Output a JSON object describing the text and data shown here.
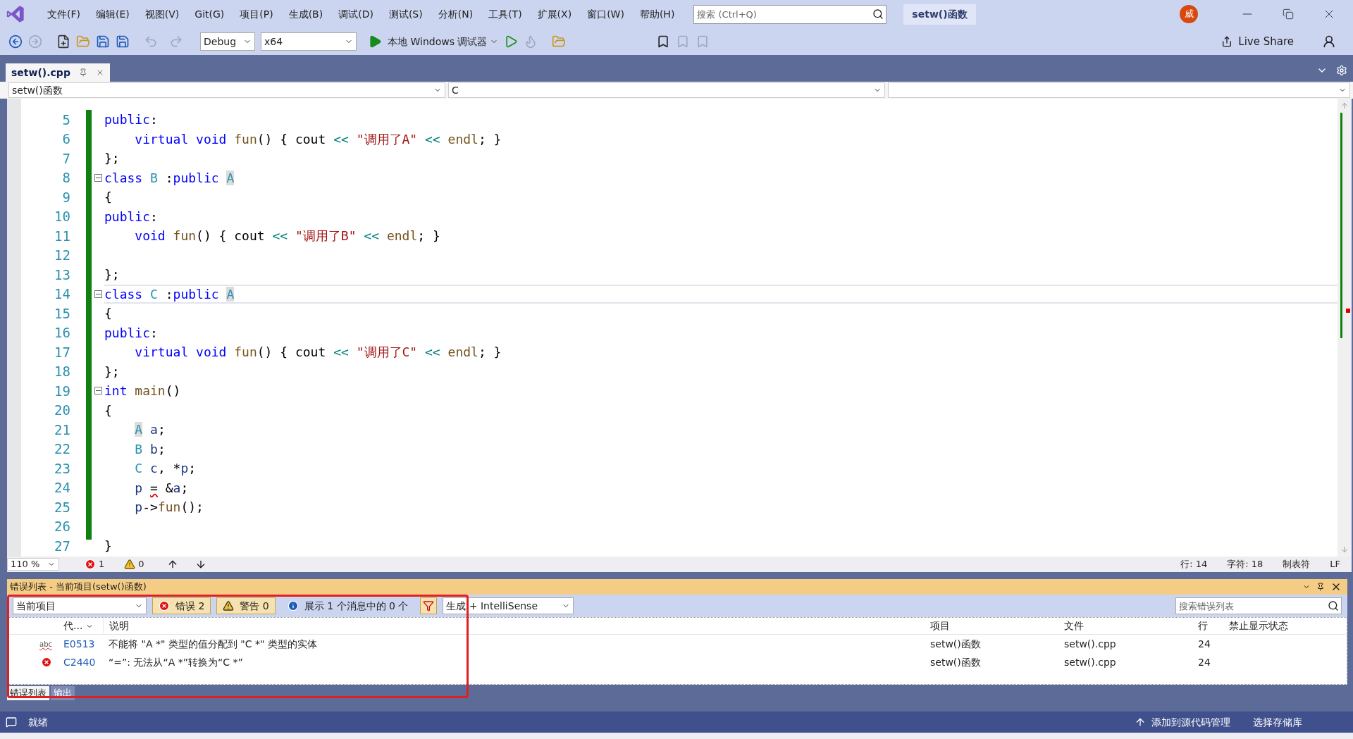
{
  "title_bar": {
    "menu": [
      "文件(F)",
      "编辑(E)",
      "视图(V)",
      "Git(G)",
      "项目(P)",
      "生成(B)",
      "调试(D)",
      "测试(S)",
      "分析(N)",
      "工具(T)",
      "扩展(X)",
      "窗口(W)",
      "帮助(H)"
    ],
    "search": {
      "placeholder": "搜索 (Ctrl+Q)"
    },
    "solution_name": "setw()函数",
    "avatar": "威"
  },
  "toolbar": {
    "configuration": "Debug",
    "platform": "x64",
    "run_target": "本地 Windows 调试器",
    "live_share": "Live Share"
  },
  "document_tab": {
    "title": "setw().cpp",
    "selected": true
  },
  "nav_bar": {
    "scope": "setw()函数",
    "class": "C"
  },
  "code": {
    "lines": [
      {
        "number": "5",
        "fold": false,
        "current": false,
        "tokens": [
          {
            "kind": "kw",
            "text": "public"
          },
          {
            "kind": "plain",
            "text": ":"
          }
        ]
      },
      {
        "number": "6",
        "fold": false,
        "current": false,
        "tokens": [
          {
            "kind": "kw",
            "text": "    virtual void"
          },
          {
            "kind": "fn",
            "text": " fun"
          },
          {
            "kind": "plain",
            "text": "() { cout "
          },
          {
            "kind": "op",
            "text": "<<"
          },
          {
            "kind": "str",
            "text": " \"调用了A\""
          },
          {
            "kind": "op",
            "text": " <<"
          },
          {
            "kind": "fn",
            "text": " endl"
          },
          {
            "kind": "plain",
            "text": "; }"
          }
        ]
      },
      {
        "number": "7",
        "fold": false,
        "current": false,
        "tokens": [
          {
            "kind": "plain",
            "text": "};"
          }
        ]
      },
      {
        "number": "8",
        "fold": true,
        "current": false,
        "tokens": [
          {
            "kind": "kw",
            "text": "class"
          },
          {
            "kind": "type",
            "text": " B"
          },
          {
            "kind": "plain",
            "text": " :"
          },
          {
            "kind": "kw",
            "text": "public "
          },
          {
            "kind": "type_hl",
            "text": "A"
          }
        ]
      },
      {
        "number": "9",
        "fold": false,
        "current": false,
        "tokens": [
          {
            "kind": "plain",
            "text": "{"
          }
        ]
      },
      {
        "number": "10",
        "fold": false,
        "current": false,
        "tokens": [
          {
            "kind": "kw",
            "text": "public"
          },
          {
            "kind": "plain",
            "text": ":"
          }
        ]
      },
      {
        "number": "11",
        "fold": false,
        "current": false,
        "tokens": [
          {
            "kind": "kw",
            "text": "    void"
          },
          {
            "kind": "fn",
            "text": " fun"
          },
          {
            "kind": "plain",
            "text": "() { cout "
          },
          {
            "kind": "op",
            "text": "<<"
          },
          {
            "kind": "str",
            "text": " \"调用了B\""
          },
          {
            "kind": "op",
            "text": " <<"
          },
          {
            "kind": "fn",
            "text": " endl"
          },
          {
            "kind": "plain",
            "text": "; }"
          }
        ]
      },
      {
        "number": "12"
      },
      {
        "number": "13",
        "fold": false,
        "current": false,
        "tokens": [
          {
            "kind": "plain",
            "text": "};"
          }
        ]
      },
      {
        "number": "14",
        "fold": true,
        "current": true,
        "tokens": [
          {
            "kind": "kw",
            "text": "class"
          },
          {
            "kind": "type",
            "text": " C"
          },
          {
            "kind": "plain",
            "text": " :"
          },
          {
            "kind": "kw",
            "text": "public "
          },
          {
            "kind": "type_hl",
            "text": "A"
          }
        ]
      },
      {
        "number": "15",
        "fold": false,
        "current": false,
        "tokens": [
          {
            "kind": "plain",
            "text": "{"
          }
        ]
      },
      {
        "number": "16",
        "fold": false,
        "current": false,
        "tokens": [
          {
            "kind": "kw",
            "text": "public"
          },
          {
            "kind": "plain",
            "text": ":"
          }
        ]
      },
      {
        "number": "17",
        "fold": false,
        "current": false,
        "tokens": [
          {
            "kind": "kw",
            "text": "    virtual void"
          },
          {
            "kind": "fn",
            "text": " fun"
          },
          {
            "kind": "plain",
            "text": "() { cout "
          },
          {
            "kind": "op",
            "text": "<<"
          },
          {
            "kind": "str",
            "text": " \"调用了C\""
          },
          {
            "kind": "op",
            "text": " <<"
          },
          {
            "kind": "fn",
            "text": " endl"
          },
          {
            "kind": "plain",
            "text": "; }"
          }
        ]
      },
      {
        "number": "18",
        "fold": false,
        "current": false,
        "tokens": [
          {
            "kind": "plain",
            "text": "};"
          }
        ]
      },
      {
        "number": "19",
        "fold": true,
        "current": false,
        "tokens": [
          {
            "kind": "kw",
            "text": "int"
          },
          {
            "kind": "fn",
            "text": " main"
          },
          {
            "kind": "plain",
            "text": "()"
          }
        ]
      },
      {
        "number": "20",
        "fold": false,
        "current": false,
        "tokens": [
          {
            "kind": "plain",
            "text": "{"
          }
        ]
      },
      {
        "number": "21",
        "fold": false,
        "current": false,
        "tokens": [
          {
            "kind": "type_hl",
            "text": "    A"
          },
          {
            "kind": "var",
            "text": " a"
          },
          {
            "kind": "plain",
            "text": ";"
          }
        ]
      },
      {
        "number": "22",
        "fold": false,
        "current": false,
        "tokens": [
          {
            "kind": "type",
            "text": "    B"
          },
          {
            "kind": "var",
            "text": " b"
          },
          {
            "kind": "plain",
            "text": ";"
          }
        ]
      },
      {
        "number": "23",
        "fold": false,
        "current": false,
        "tokens": [
          {
            "kind": "type",
            "text": "    C"
          },
          {
            "kind": "var",
            "text": " c"
          },
          {
            "kind": "plain",
            "text": ", *"
          },
          {
            "kind": "var",
            "text": "p"
          },
          {
            "kind": "plain",
            "text": ";"
          }
        ]
      },
      {
        "number": "24",
        "fold": false,
        "current": false,
        "tokens": [
          {
            "kind": "var",
            "text": "    p "
          },
          {
            "kind": "error",
            "text": "="
          },
          {
            "kind": "plain",
            "text": " &"
          },
          {
            "kind": "var",
            "text": "a"
          },
          {
            "kind": "plain",
            "text": ";"
          }
        ]
      },
      {
        "number": "25",
        "fold": false,
        "current": false,
        "tokens": [
          {
            "kind": "var",
            "text": "    p"
          },
          {
            "kind": "plain",
            "text": "->"
          },
          {
            "kind": "fn",
            "text": "fun"
          },
          {
            "kind": "plain",
            "text": "();"
          }
        ]
      },
      {
        "number": "26"
      },
      {
        "number": "27",
        "fold": false,
        "current": false,
        "tokens": [
          {
            "kind": "plain",
            "text": "}"
          }
        ]
      }
    ]
  },
  "editor_status": {
    "zoom": "110 %",
    "errors": "1",
    "warnings": "0",
    "line": "行: 14",
    "char": "字符: 18",
    "indent": "制表符",
    "line_ending": "LF"
  },
  "error_list": {
    "title": "错误列表 - 当前项目(setw()函数)",
    "scope": "当前项目",
    "errors_filter": {
      "label": "错误 2",
      "on": true
    },
    "warnings_filter": {
      "label": "警告 0",
      "on": true
    },
    "messages_filter": {
      "label": "展示 1 个消息中的 0 个",
      "on": false
    },
    "source": "生成 + IntelliSense",
    "search_placeholder": "搜索错误列表",
    "columns": [
      "代...",
      "说明",
      "项目",
      "文件",
      "行",
      "禁止显示状态"
    ],
    "rows": [
      {
        "kind": "intellisense",
        "icon_label": "abc",
        "code": "E0513",
        "description": "不能将 \"A *\" 类型的值分配到 \"C *\" 类型的实体",
        "project": "setw()函数",
        "file": "setw().cpp",
        "line": "24"
      },
      {
        "kind": "build",
        "code": "C2440",
        "description": "“=”: 无法从“A *”转换为“C *”",
        "project": "setw()函数",
        "file": "setw().cpp",
        "line": "24"
      }
    ],
    "tabs": [
      {
        "label": "错误列表",
        "selected": true
      },
      {
        "label": "输出",
        "selected": false
      }
    ]
  },
  "status_bar": {
    "status": "就绪",
    "source_control": "添加到源代码管理",
    "repository": "选择存储库"
  }
}
